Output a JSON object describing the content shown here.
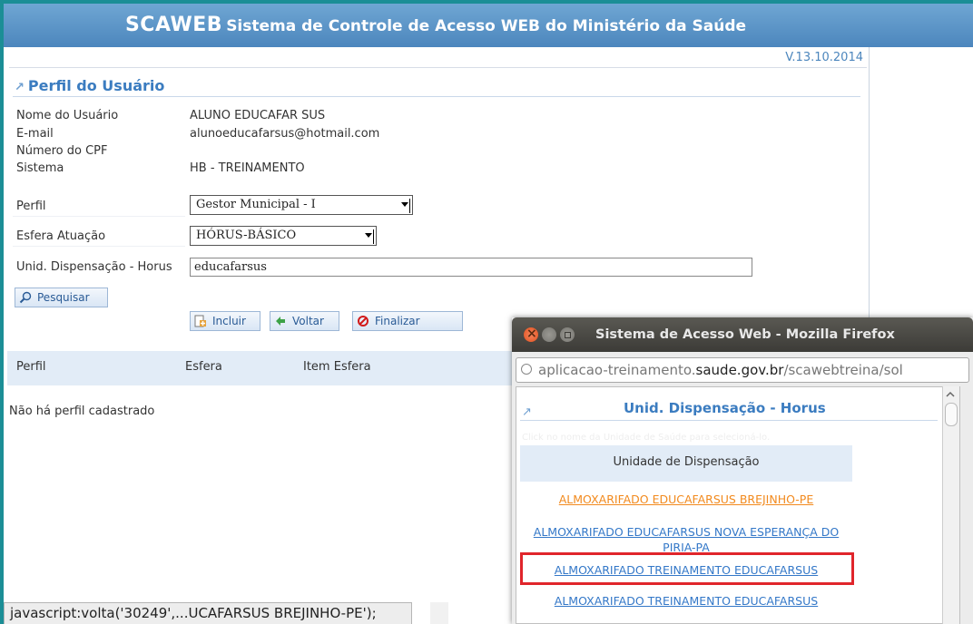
{
  "header": {
    "brand": "SCAWEB",
    "subtitle": "Sistema de Controle de Acesso WEB do Ministério da Saúde"
  },
  "version": "V.13.10.2014",
  "section_title": "Perfil do Usuário",
  "user": {
    "name_label": "Nome do Usuário",
    "name": "ALUNO EDUCAFAR SUS",
    "email_label": "E-mail",
    "email": "alunoeducafarsus@hotmail.com",
    "cpf_label": "Número do CPF",
    "cpf": "",
    "system_label": "Sistema",
    "system": "HB - TREINAMENTO"
  },
  "form": {
    "perfil_label": "Perfil",
    "perfil_value": "Gestor Municipal - I",
    "esfera_label": "Esfera Atuação",
    "esfera_value": "HÓRUS-BÁSICO",
    "unid_label": "Unid. Dispensação - Horus",
    "unid_value": "educafarsus"
  },
  "buttons": {
    "pesquisar": "Pesquisar",
    "incluir": "Incluir",
    "voltar": "Voltar",
    "finalizar": "Finalizar"
  },
  "table": {
    "columns": [
      "Perfil",
      "Esfera",
      "Item Esfera"
    ],
    "empty_message": "Não há perfil cadastrado"
  },
  "popup": {
    "window_title": "Sistema de Acesso Web - Mozilla Firefox",
    "url_prefix": "aplicacao-treinamento.",
    "url_domain": "saude.gov.br",
    "url_path": "/scawebtreina/sol",
    "title": "Unid. Dispensação - Horus",
    "hint": "Click no nome da Unidade de Saúde para selecioná-lo.",
    "column_header": "Unidade de Dispensação",
    "items": [
      "ALMOXARIFADO EDUCAFARSUS BREJINHO-PE",
      "ALMOXARIFADO EDUCAFARSUS NOVA ESPERANÇA DO PIRIA-PA",
      "ALMOXARIFADO TREINAMENTO EDUCAFARSUS",
      "ALMOXARIFADO TREINAMENTO EDUCAFARSUS"
    ],
    "status": "javascript:volta('30249',...UCAFARSUS BREJINHO-PE');"
  }
}
